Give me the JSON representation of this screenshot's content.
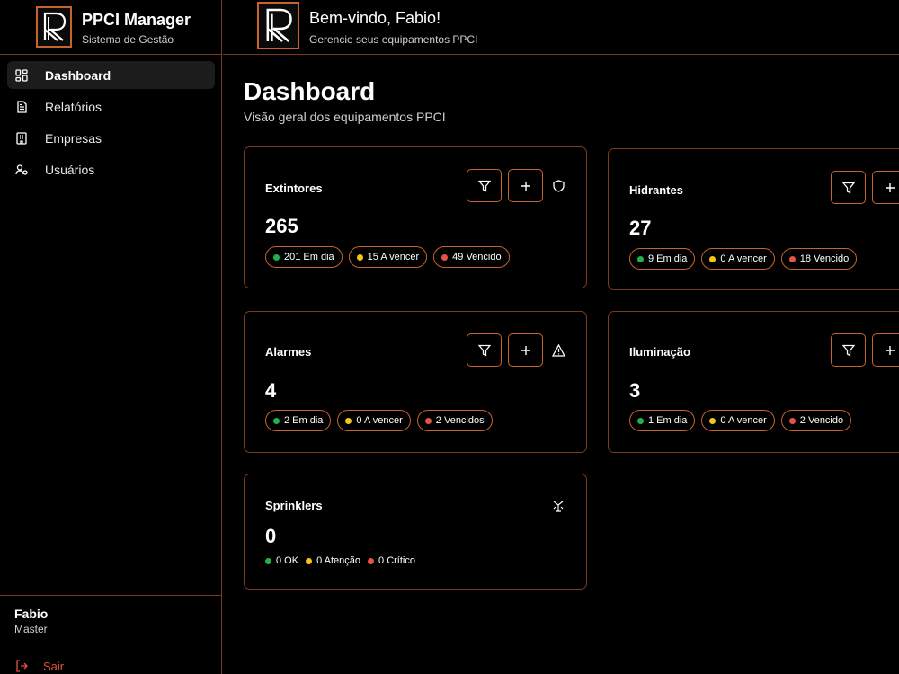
{
  "brand": {
    "title": "PPCI Manager",
    "subtitle": "Sistema de Gestão",
    "logo_icon": "logo-r-icon"
  },
  "nav": {
    "items": [
      {
        "label": "Dashboard",
        "icon": "dashboard-icon"
      },
      {
        "label": "Relatórios",
        "icon": "document-icon"
      },
      {
        "label": "Empresas",
        "icon": "building-icon"
      },
      {
        "label": "Usuários",
        "icon": "users-icon"
      }
    ],
    "active": "Dashboard"
  },
  "user": {
    "name": "Fabio",
    "role": "Master",
    "logout_label": "Sair"
  },
  "header": {
    "welcome": "Bem-vindo, Fabio!",
    "subtitle": "Gerencie seus equipamentos PPCI"
  },
  "page": {
    "title": "Dashboard",
    "subtitle": "Visão geral dos equipamentos PPCI"
  },
  "colors": {
    "accent": "#c8622e",
    "border": "#7a3b1d",
    "ok": "#22b24c",
    "warn": "#f5c518",
    "danger": "#e5534b",
    "logout": "#e0533b"
  },
  "cards": {
    "extintores": {
      "title": "Extintores",
      "count": "265",
      "icon": "shield-icon",
      "stats": [
        "201 Em dia",
        "15 A vencer",
        "49 Vencido"
      ]
    },
    "hidrantes": {
      "title": "Hidrantes",
      "count": "27",
      "stats": [
        "9 Em dia",
        "0 A vencer",
        "18 Vencido"
      ]
    },
    "alarmes": {
      "title": "Alarmes",
      "count": "4",
      "icon": "warning-icon",
      "stats": [
        "2 Em dia",
        "0 A vencer",
        "2 Vencidos"
      ]
    },
    "iluminacao": {
      "title": "Iluminação",
      "count": "3",
      "stats": [
        "1 Em dia",
        "0 A vencer",
        "2 Vencido"
      ]
    },
    "sprinklers": {
      "title": "Sprinklers",
      "count": "0",
      "icon": "sprinkler-icon",
      "stats": [
        "0 OK",
        "0 Atenção",
        "0 Crítico"
      ]
    }
  }
}
